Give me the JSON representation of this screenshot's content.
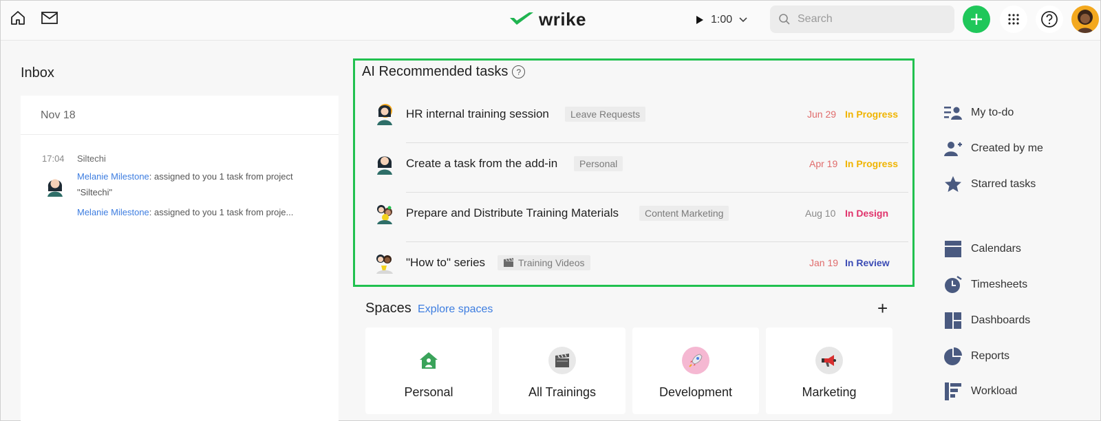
{
  "topbar": {
    "logo_text": "wrike",
    "timer": "1:00",
    "search_placeholder": "Search"
  },
  "inbox": {
    "title": "Inbox",
    "date": "Nov 18",
    "message": {
      "time": "17:04",
      "project": "Siltechi",
      "author": "Melanie Milestone",
      "text1": ": assigned to you 1 task from project",
      "text1b": "\"Siltechi\"",
      "text2": ": assigned to you 1 task from proje..."
    }
  },
  "ai_tasks": {
    "title": "AI Recommended tasks",
    "tasks": [
      {
        "name": "HR internal training session",
        "tag": "Leave Requests",
        "date": "Jun 29",
        "status": "In Progress"
      },
      {
        "name": "Create a task from the add-in",
        "tag": "Personal",
        "date": "Apr 19",
        "status": "In Progress"
      },
      {
        "name": "Prepare and Distribute Training Materials",
        "tag": "Content Marketing",
        "date": "Aug 10",
        "status": "In Design"
      },
      {
        "name": "\"How to\" series",
        "tag": "Training Videos",
        "date": "Jan 19",
        "status": "In Review"
      }
    ]
  },
  "colors": {
    "accent_green": "#21c14f",
    "date_red": "#e06b6b",
    "date_gray": "#888888",
    "status_in_progress": "#f0b400",
    "status_in_design": "#e0336b",
    "status_in_review": "#3b4bb5"
  },
  "spaces": {
    "title": "Spaces",
    "explore_link": "Explore spaces",
    "add_label": "+",
    "items": [
      {
        "label": "Personal",
        "icon": "house-icon"
      },
      {
        "label": "All Trainings",
        "icon": "clapperboard-icon"
      },
      {
        "label": "Development",
        "icon": "rocket-icon"
      },
      {
        "label": "Marketing",
        "icon": "megaphone-icon"
      }
    ]
  },
  "nav": {
    "items": [
      {
        "label": "My to-do",
        "icon": "todo-list-icon"
      },
      {
        "label": "Created by me",
        "icon": "user-plus-icon"
      },
      {
        "label": "Starred tasks",
        "icon": "star-icon"
      },
      {
        "label": "Calendars",
        "icon": "calendar-icon"
      },
      {
        "label": "Timesheets",
        "icon": "stopwatch-icon"
      },
      {
        "label": "Dashboards",
        "icon": "dashboard-icon"
      },
      {
        "label": "Reports",
        "icon": "pie-chart-icon"
      },
      {
        "label": "Workload",
        "icon": "workload-icon"
      }
    ]
  }
}
